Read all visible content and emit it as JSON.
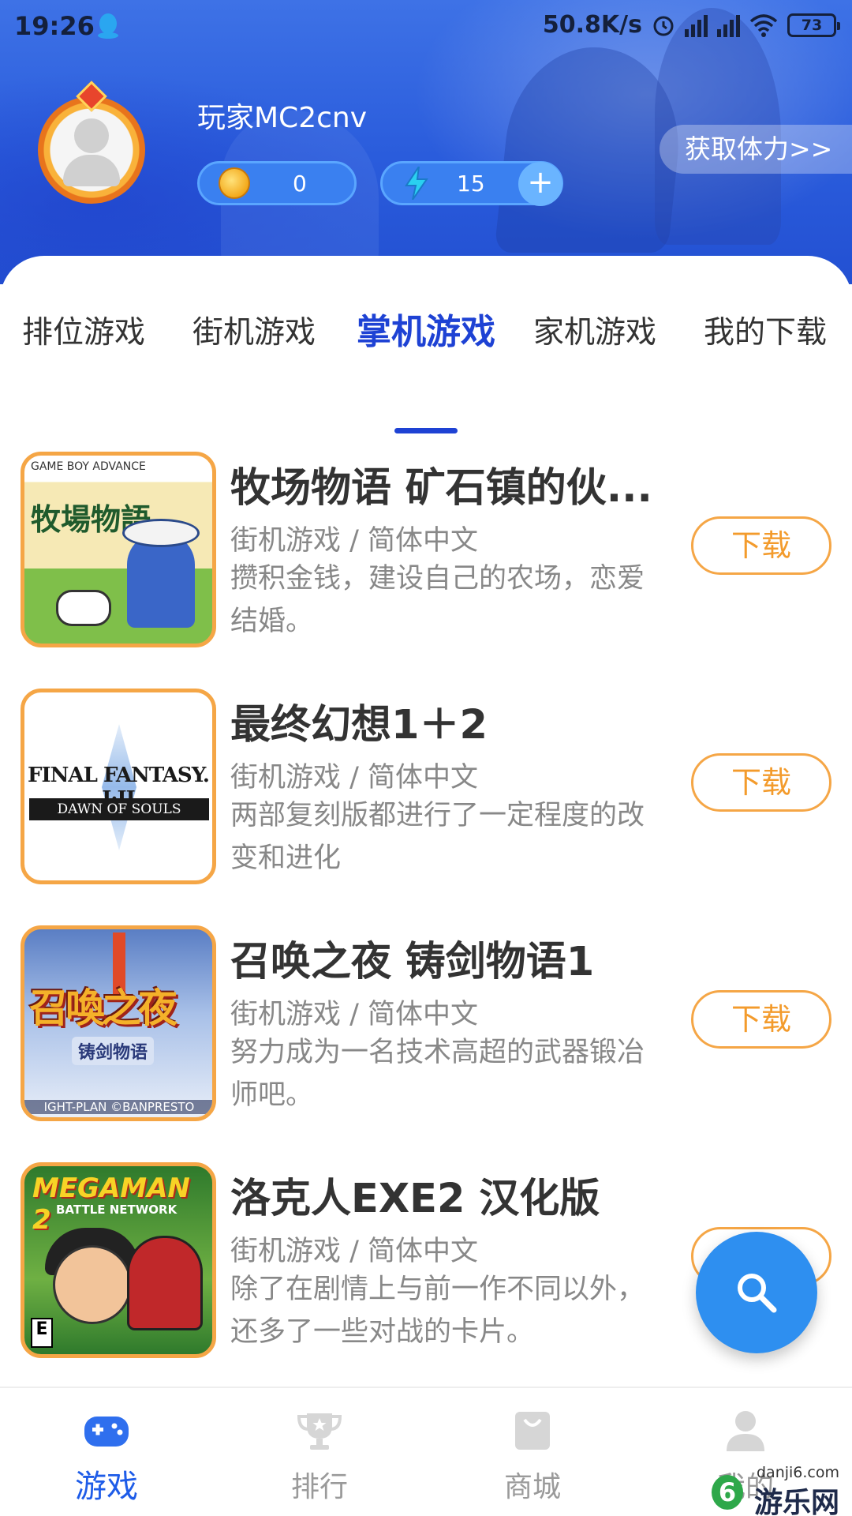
{
  "status_bar": {
    "time": "19:26",
    "network_speed": "50.8K/s",
    "battery": "73"
  },
  "profile": {
    "username": "玩家MC2cnv",
    "coins": "0",
    "energy": "15",
    "get_energy_label": "获取体力>>"
  },
  "tabs": [
    {
      "label": "排位游戏",
      "active": false
    },
    {
      "label": "街机游戏",
      "active": false
    },
    {
      "label": "掌机游戏",
      "active": true
    },
    {
      "label": "家机游戏",
      "active": false
    },
    {
      "label": "我的下载",
      "active": false
    }
  ],
  "games": [
    {
      "title": "牧场物语 矿石镇的伙...",
      "category": "街机游戏 / 简体中文",
      "description": "攒积金钱，建设自己的农场，恋爱结婚。",
      "download_label": "下载",
      "cover_text": "牧場物語",
      "cover_caption": "GAME BOY ADVANCE"
    },
    {
      "title": "最终幻想1＋2",
      "category": "街机游戏 / 简体中文",
      "description": "两部复刻版都进行了一定程度的改变和进化",
      "download_label": "下载",
      "cover_text": "FINAL FANTASY. I·II",
      "cover_caption": "DAWN OF SOULS"
    },
    {
      "title": "召唤之夜 铸剑物语1",
      "category": "街机游戏 / 简体中文",
      "description": "努力成为一名技术高超的武器锻冶师吧。",
      "download_label": "下载",
      "cover_text": "召喚之夜",
      "cover_caption": "铸剑物语",
      "cover_credit": "IGHT-PLAN ©BANPRESTO"
    },
    {
      "title": "洛克人EXE2 汉化版",
      "category": "街机游戏 / 简体中文",
      "description": "除了在剧情上与前一作不同以外，还多了一些对战的卡片。",
      "download_label": "下载",
      "cover_text": "MEGAMAN 2",
      "cover_caption": "BATTLE NETWORK",
      "cover_rating": "E"
    }
  ],
  "bottom_nav": [
    {
      "label": "游戏",
      "icon": "gamepad-icon",
      "active": true
    },
    {
      "label": "排行",
      "icon": "trophy-icon",
      "active": false
    },
    {
      "label": "商城",
      "icon": "shopping-bag-icon",
      "active": false
    },
    {
      "label": "我的",
      "icon": "user-icon",
      "active": false
    }
  ],
  "watermark": {
    "url": "danji6.com",
    "name": "游乐网",
    "badge": "6"
  },
  "colors": {
    "accent": "#1e42d4",
    "download_border": "#f5a646",
    "fab": "#2e8ff0"
  }
}
